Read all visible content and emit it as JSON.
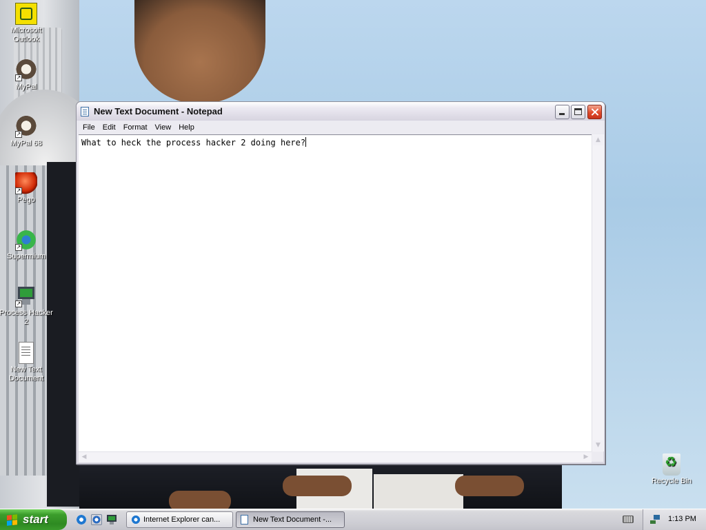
{
  "desktop": {
    "icons": [
      {
        "label": "Microsoft Outlook",
        "icon": "outlook-icon"
      },
      {
        "label": "MyPal",
        "icon": "mypal-icon"
      },
      {
        "label": "MyPal 68",
        "icon": "mypal68-icon"
      },
      {
        "label": "Pego",
        "icon": "pego-icon"
      },
      {
        "label": "Supermium",
        "icon": "supermium-icon"
      },
      {
        "label": "Process Hacker 2",
        "icon": "process-hacker-icon"
      },
      {
        "label": "New Text Document",
        "icon": "text-document-icon"
      },
      {
        "label": "Recycle Bin",
        "icon": "recycle-bin-icon"
      }
    ]
  },
  "notepad": {
    "title": "New Text Document - Notepad",
    "menu": [
      "File",
      "Edit",
      "Format",
      "View",
      "Help"
    ],
    "content": "What to heck the process hacker 2 doing here?"
  },
  "taskbar": {
    "start_label": "start",
    "tasks": [
      {
        "label": "Internet Explorer can...",
        "icon": "internet-explorer-icon",
        "active": false
      },
      {
        "label": "New Text Document -...",
        "icon": "notepad-icon",
        "active": true
      }
    ],
    "clock": "1:13 PM"
  },
  "colors": {
    "start_green": "#3c9e2c",
    "close_red": "#e04b2b",
    "desktop_sky": "#a9cbe6"
  }
}
